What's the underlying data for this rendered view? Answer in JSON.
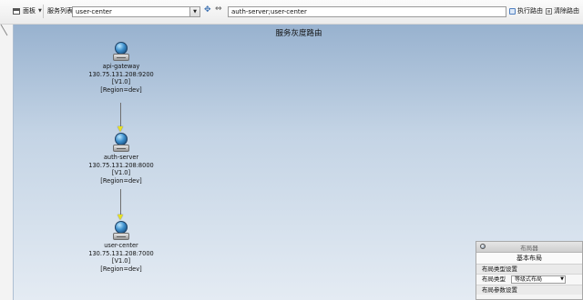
{
  "toolbar": {
    "panel_label": "面板",
    "service_list_label": "服务列表",
    "service_select_value": "user-center",
    "route_input_value": "auth-server;user-center",
    "execute_route_label": "执行路由",
    "clear_route_label": "清除路由"
  },
  "canvas": {
    "title": "服务灰度路由",
    "nodes": [
      {
        "name": "api-gateway",
        "address": "130.75.131.208:9200",
        "version": "[V1.0]",
        "region": "[Region=dev]"
      },
      {
        "name": "auth-server",
        "address": "130.75.131.208:8000",
        "version": "[V1.0]",
        "region": "[Region=dev]"
      },
      {
        "name": "user-center",
        "address": "130.75.131.208:7000",
        "version": "[V1.0]",
        "region": "[Region=dev]"
      }
    ]
  },
  "layout_panel": {
    "title": "布局器",
    "section": "基本布局",
    "type_settings_label": "布局类型设置",
    "type_label": "布局类型",
    "type_value": "等级式布局",
    "params_label": "布局参数设置"
  },
  "colors": {
    "canvas_top": "#98b2cf",
    "canvas_bottom": "#e4ebf3",
    "arrow": "#e6e020"
  }
}
